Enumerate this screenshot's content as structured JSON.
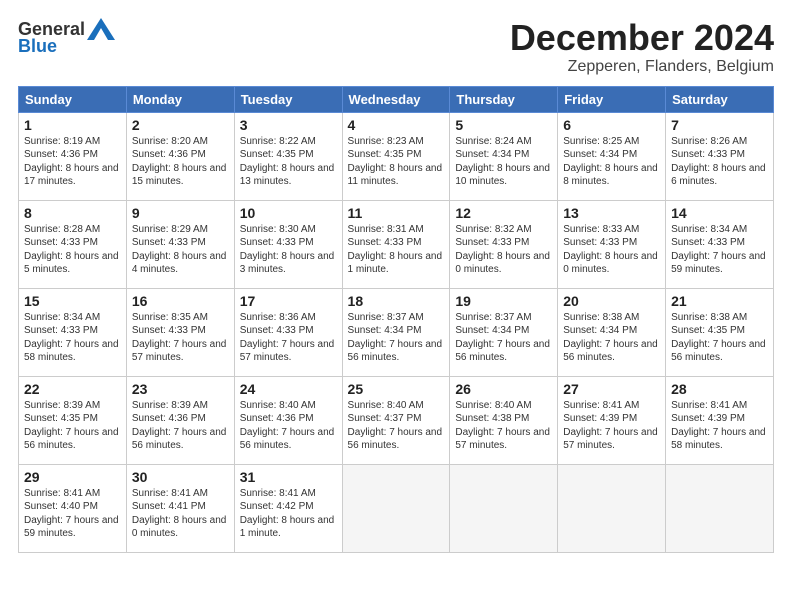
{
  "header": {
    "logo_general": "General",
    "logo_blue": "Blue",
    "month_title": "December 2024",
    "location": "Zepperen, Flanders, Belgium"
  },
  "weekdays": [
    "Sunday",
    "Monday",
    "Tuesday",
    "Wednesday",
    "Thursday",
    "Friday",
    "Saturday"
  ],
  "weeks": [
    [
      {
        "day": "1",
        "text": "Sunrise: 8:19 AM\nSunset: 4:36 PM\nDaylight: 8 hours and 17 minutes."
      },
      {
        "day": "2",
        "text": "Sunrise: 8:20 AM\nSunset: 4:36 PM\nDaylight: 8 hours and 15 minutes."
      },
      {
        "day": "3",
        "text": "Sunrise: 8:22 AM\nSunset: 4:35 PM\nDaylight: 8 hours and 13 minutes."
      },
      {
        "day": "4",
        "text": "Sunrise: 8:23 AM\nSunset: 4:35 PM\nDaylight: 8 hours and 11 minutes."
      },
      {
        "day": "5",
        "text": "Sunrise: 8:24 AM\nSunset: 4:34 PM\nDaylight: 8 hours and 10 minutes."
      },
      {
        "day": "6",
        "text": "Sunrise: 8:25 AM\nSunset: 4:34 PM\nDaylight: 8 hours and 8 minutes."
      },
      {
        "day": "7",
        "text": "Sunrise: 8:26 AM\nSunset: 4:33 PM\nDaylight: 8 hours and 6 minutes."
      }
    ],
    [
      {
        "day": "8",
        "text": "Sunrise: 8:28 AM\nSunset: 4:33 PM\nDaylight: 8 hours and 5 minutes."
      },
      {
        "day": "9",
        "text": "Sunrise: 8:29 AM\nSunset: 4:33 PM\nDaylight: 8 hours and 4 minutes."
      },
      {
        "day": "10",
        "text": "Sunrise: 8:30 AM\nSunset: 4:33 PM\nDaylight: 8 hours and 3 minutes."
      },
      {
        "day": "11",
        "text": "Sunrise: 8:31 AM\nSunset: 4:33 PM\nDaylight: 8 hours and 1 minute."
      },
      {
        "day": "12",
        "text": "Sunrise: 8:32 AM\nSunset: 4:33 PM\nDaylight: 8 hours and 0 minutes."
      },
      {
        "day": "13",
        "text": "Sunrise: 8:33 AM\nSunset: 4:33 PM\nDaylight: 8 hours and 0 minutes."
      },
      {
        "day": "14",
        "text": "Sunrise: 8:34 AM\nSunset: 4:33 PM\nDaylight: 7 hours and 59 minutes."
      }
    ],
    [
      {
        "day": "15",
        "text": "Sunrise: 8:34 AM\nSunset: 4:33 PM\nDaylight: 7 hours and 58 minutes."
      },
      {
        "day": "16",
        "text": "Sunrise: 8:35 AM\nSunset: 4:33 PM\nDaylight: 7 hours and 57 minutes."
      },
      {
        "day": "17",
        "text": "Sunrise: 8:36 AM\nSunset: 4:33 PM\nDaylight: 7 hours and 57 minutes."
      },
      {
        "day": "18",
        "text": "Sunrise: 8:37 AM\nSunset: 4:34 PM\nDaylight: 7 hours and 56 minutes."
      },
      {
        "day": "19",
        "text": "Sunrise: 8:37 AM\nSunset: 4:34 PM\nDaylight: 7 hours and 56 minutes."
      },
      {
        "day": "20",
        "text": "Sunrise: 8:38 AM\nSunset: 4:34 PM\nDaylight: 7 hours and 56 minutes."
      },
      {
        "day": "21",
        "text": "Sunrise: 8:38 AM\nSunset: 4:35 PM\nDaylight: 7 hours and 56 minutes."
      }
    ],
    [
      {
        "day": "22",
        "text": "Sunrise: 8:39 AM\nSunset: 4:35 PM\nDaylight: 7 hours and 56 minutes."
      },
      {
        "day": "23",
        "text": "Sunrise: 8:39 AM\nSunset: 4:36 PM\nDaylight: 7 hours and 56 minutes."
      },
      {
        "day": "24",
        "text": "Sunrise: 8:40 AM\nSunset: 4:36 PM\nDaylight: 7 hours and 56 minutes."
      },
      {
        "day": "25",
        "text": "Sunrise: 8:40 AM\nSunset: 4:37 PM\nDaylight: 7 hours and 56 minutes."
      },
      {
        "day": "26",
        "text": "Sunrise: 8:40 AM\nSunset: 4:38 PM\nDaylight: 7 hours and 57 minutes."
      },
      {
        "day": "27",
        "text": "Sunrise: 8:41 AM\nSunset: 4:39 PM\nDaylight: 7 hours and 57 minutes."
      },
      {
        "day": "28",
        "text": "Sunrise: 8:41 AM\nSunset: 4:39 PM\nDaylight: 7 hours and 58 minutes."
      }
    ],
    [
      {
        "day": "29",
        "text": "Sunrise: 8:41 AM\nSunset: 4:40 PM\nDaylight: 7 hours and 59 minutes."
      },
      {
        "day": "30",
        "text": "Sunrise: 8:41 AM\nSunset: 4:41 PM\nDaylight: 8 hours and 0 minutes."
      },
      {
        "day": "31",
        "text": "Sunrise: 8:41 AM\nSunset: 4:42 PM\nDaylight: 8 hours and 1 minute."
      },
      {
        "day": "",
        "text": ""
      },
      {
        "day": "",
        "text": ""
      },
      {
        "day": "",
        "text": ""
      },
      {
        "day": "",
        "text": ""
      }
    ]
  ]
}
